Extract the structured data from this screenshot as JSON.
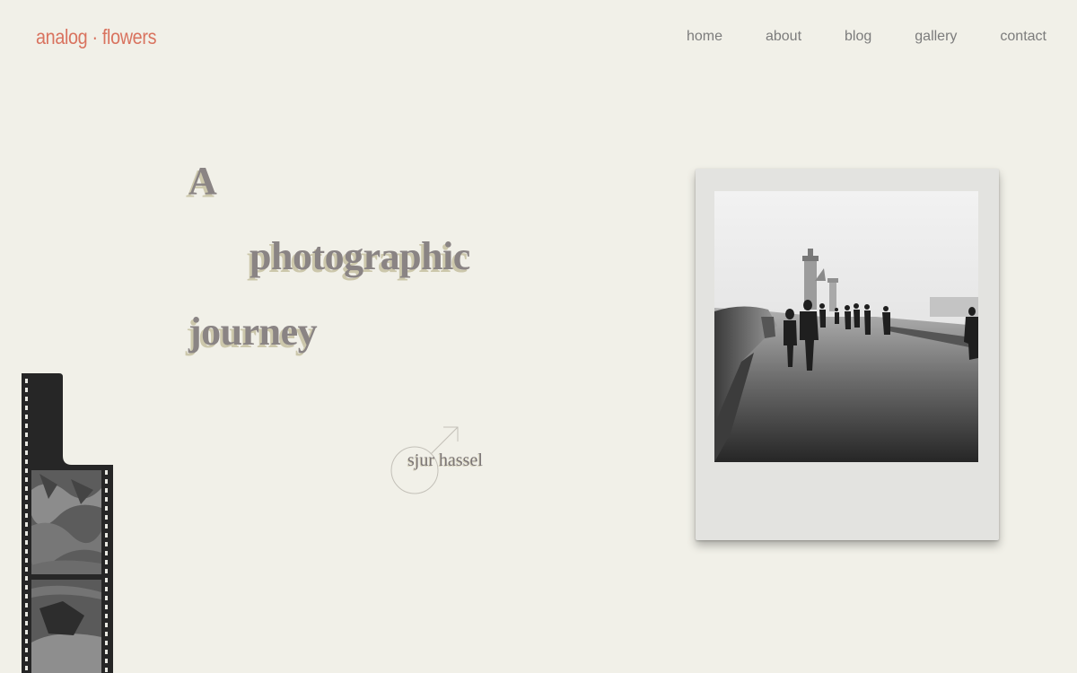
{
  "header": {
    "logo": "analog · flowers",
    "nav": [
      {
        "label": "home"
      },
      {
        "label": "about"
      },
      {
        "label": "blog"
      },
      {
        "label": "gallery"
      },
      {
        "label": "contact"
      }
    ]
  },
  "hero": {
    "lines": [
      "A",
      "photographic",
      "journey"
    ],
    "signature": "sjur hassel"
  },
  "colors": {
    "background": "#f1f0e8",
    "accent": "#d9735f",
    "headline": "#8a8484",
    "headline_shadow": "#ccc7ab",
    "nav_text": "#7c7c7c"
  },
  "icons": {
    "signature_mark": "male-symbol-icon"
  },
  "images": {
    "polaroid": "black-and-white pier with lighthouse and walking people",
    "film_strip": "35mm film strip"
  }
}
